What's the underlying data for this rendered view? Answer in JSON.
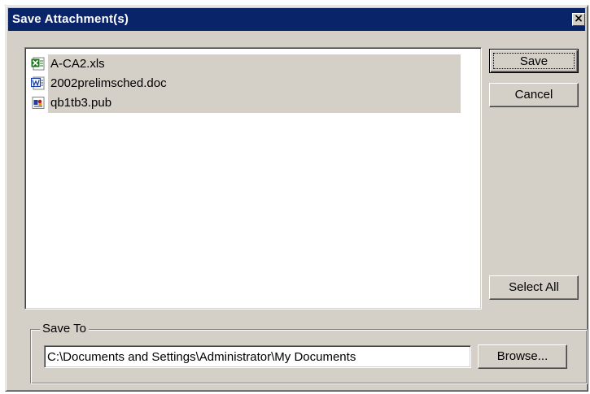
{
  "window": {
    "title": "Save Attachment(s)",
    "close_glyph": "×"
  },
  "files": [
    {
      "name": "A-CA2.xls",
      "icon": "excel-icon",
      "selected": true
    },
    {
      "name": "2002prelimsched.doc",
      "icon": "word-icon",
      "selected": true
    },
    {
      "name": "qb1tb3.pub",
      "icon": "publisher-icon",
      "selected": true
    }
  ],
  "buttons": {
    "save": "Save",
    "cancel": "Cancel",
    "select_all": "Select All",
    "browse": "Browse..."
  },
  "save_to": {
    "label": "Save To",
    "path": "C:\\Documents and Settings\\Administrator\\My Documents"
  },
  "colors": {
    "titlebar": "#0a246a",
    "face": "#d4d0c8",
    "selection": "#d4d0c8"
  }
}
